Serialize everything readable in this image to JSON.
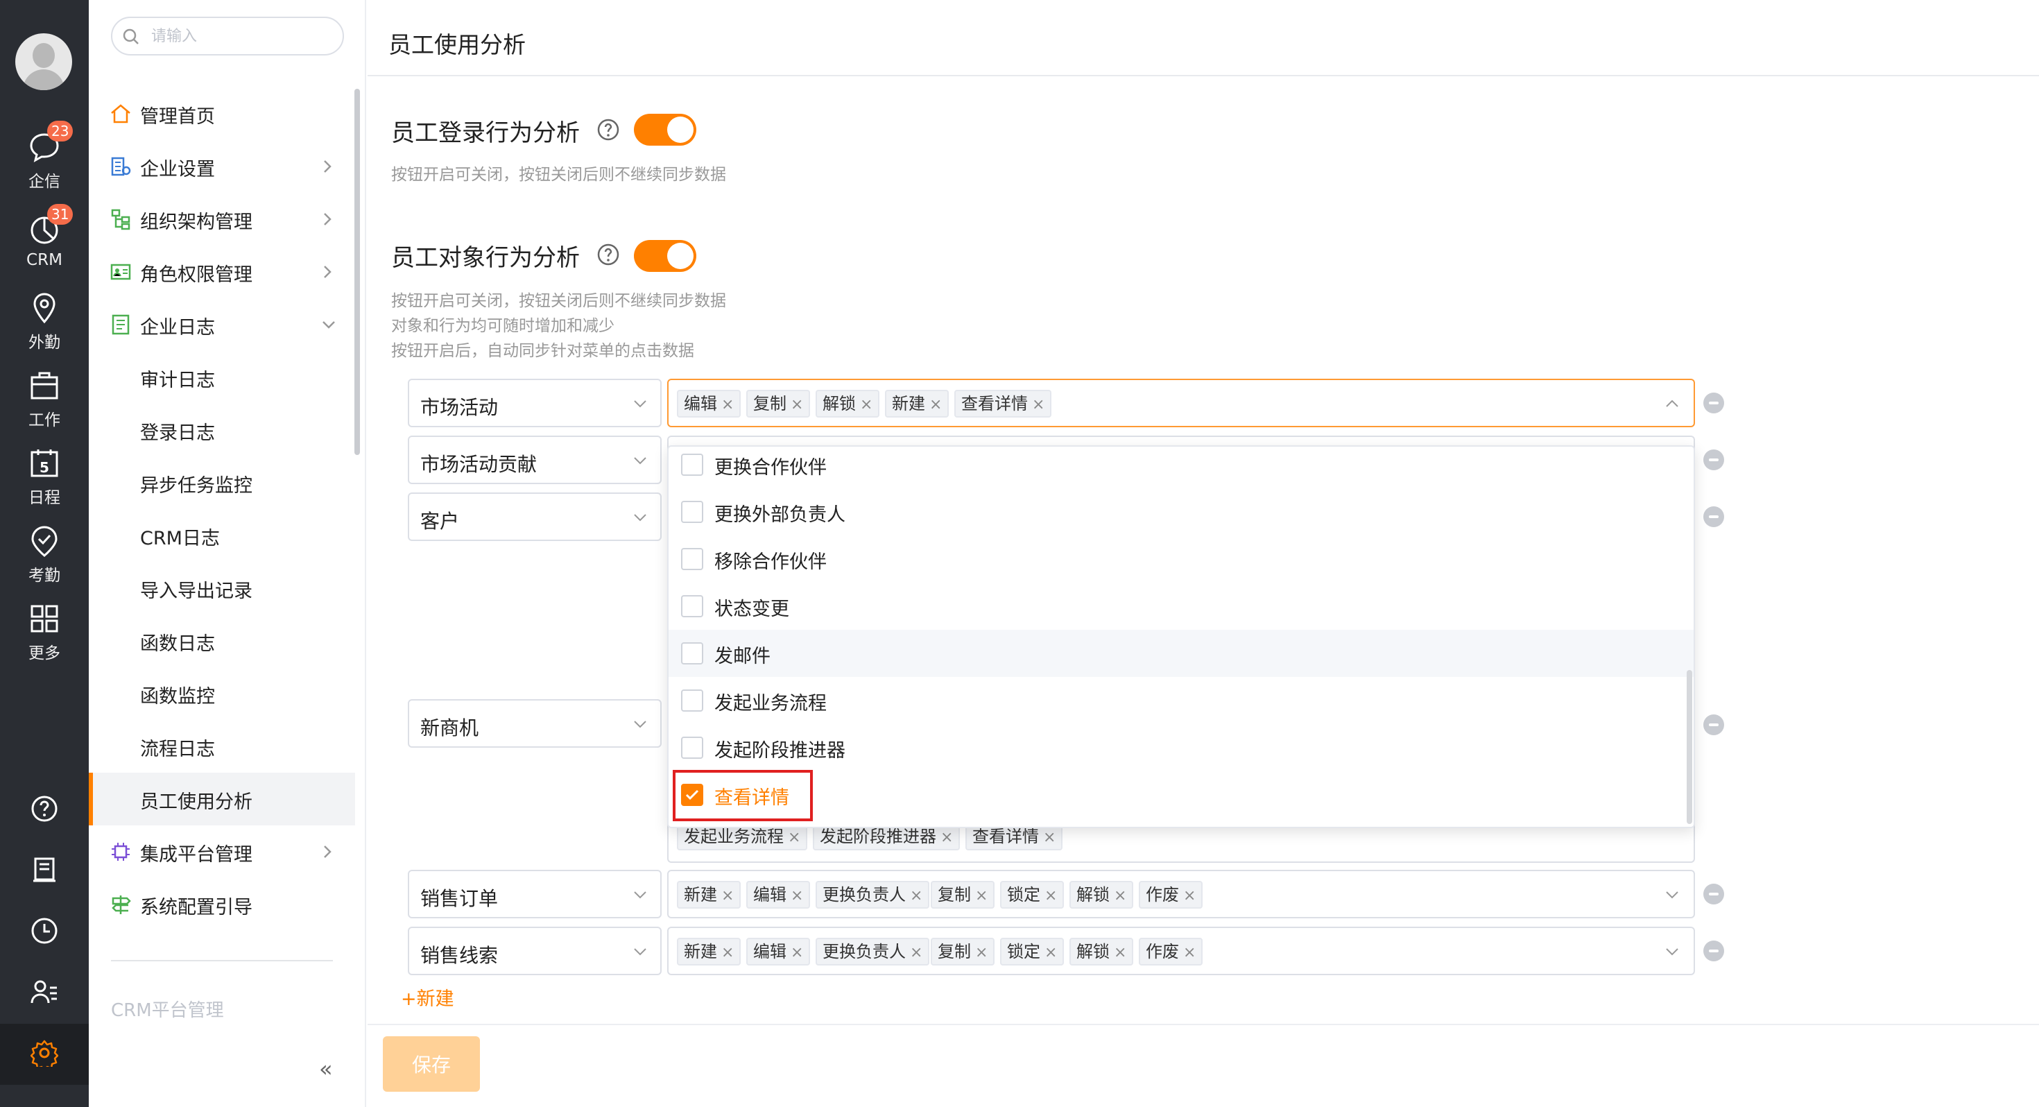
{
  "rail": {
    "items": [
      {
        "label": "企信",
        "badge": "23"
      },
      {
        "label": "CRM",
        "badge": "31"
      },
      {
        "label": "外勤"
      },
      {
        "label": "工作"
      },
      {
        "label": "日程",
        "icon_text": "5"
      },
      {
        "label": "考勤"
      },
      {
        "label": "更多"
      }
    ],
    "bottom_icons": [
      "help-icon",
      "notebook-icon",
      "clock-icon",
      "user-list-icon",
      "gear-icon"
    ]
  },
  "nav": {
    "search_placeholder": "请输入",
    "items": [
      {
        "label": "管理首页",
        "icon": "home-icon"
      },
      {
        "label": "企业设置",
        "icon": "building-icon"
      },
      {
        "label": "组织架构管理",
        "icon": "org-tree-icon"
      },
      {
        "label": "角色权限管理",
        "icon": "id-card-icon"
      },
      {
        "label": "企业日志",
        "icon": "log-icon"
      }
    ],
    "sub_items": [
      "审计日志",
      "登录日志",
      "异步任务监控",
      "CRM日志",
      "导入导出记录",
      "函数日志",
      "函数监控",
      "流程日志",
      "员工使用分析"
    ],
    "active_sub": "员工使用分析",
    "items_after": [
      {
        "label": "集成平台管理",
        "icon": "chip-icon"
      },
      {
        "label": "系统配置引导",
        "icon": "signpost-icon"
      }
    ],
    "platform_label": "CRM平台管理",
    "collapse_label": "«"
  },
  "main": {
    "title": "员工使用分析",
    "login_section": {
      "title": "员工登录行为分析",
      "enabled": true,
      "desc": "按钮开启可关闭，按钮关闭后则不继续同步数据"
    },
    "object_section": {
      "title": "员工对象行为分析",
      "enabled": true,
      "desc": [
        "按钮开启可关闭，按钮关闭后则不继续同步数据",
        "对象和行为均可随时增加和减少",
        "按钮开启后，自动同步针对菜单的点击数据"
      ]
    },
    "rows": [
      {
        "object": "市场活动",
        "tags": [
          "编辑",
          "复制",
          "解锁",
          "新建",
          "查看详情"
        ]
      },
      {
        "object": "市场活动贡献",
        "tags": []
      },
      {
        "object": "客户",
        "tags": []
      },
      {
        "object": "新商机",
        "tags": [
          "发起业务流程",
          "发起阶段推进器",
          "查看详情"
        ]
      },
      {
        "object": "销售订单",
        "tags": [
          "新建",
          "编辑",
          "更换负责人",
          "复制",
          "锁定",
          "解锁",
          "作废"
        ]
      },
      {
        "object": "销售线索",
        "tags": [
          "新建",
          "编辑",
          "更换负责人",
          "复制",
          "锁定",
          "解锁",
          "作废"
        ]
      }
    ],
    "dropdown_options": [
      {
        "label": "更换合作伙伴",
        "checked": false
      },
      {
        "label": "更换外部负责人",
        "checked": false
      },
      {
        "label": "移除合作伙伴",
        "checked": false
      },
      {
        "label": "状态变更",
        "checked": false
      },
      {
        "label": "发邮件",
        "checked": false
      },
      {
        "label": "发起业务流程",
        "checked": false
      },
      {
        "label": "发起阶段推进器",
        "checked": false
      },
      {
        "label": "查看详情",
        "checked": true
      }
    ],
    "add_label": "+新建",
    "save_label": "保存"
  },
  "colors": {
    "accent": "#ff8000",
    "rail_bg": "#2a2d33",
    "badge": "#f56c4a",
    "highlight": "#e02020"
  }
}
